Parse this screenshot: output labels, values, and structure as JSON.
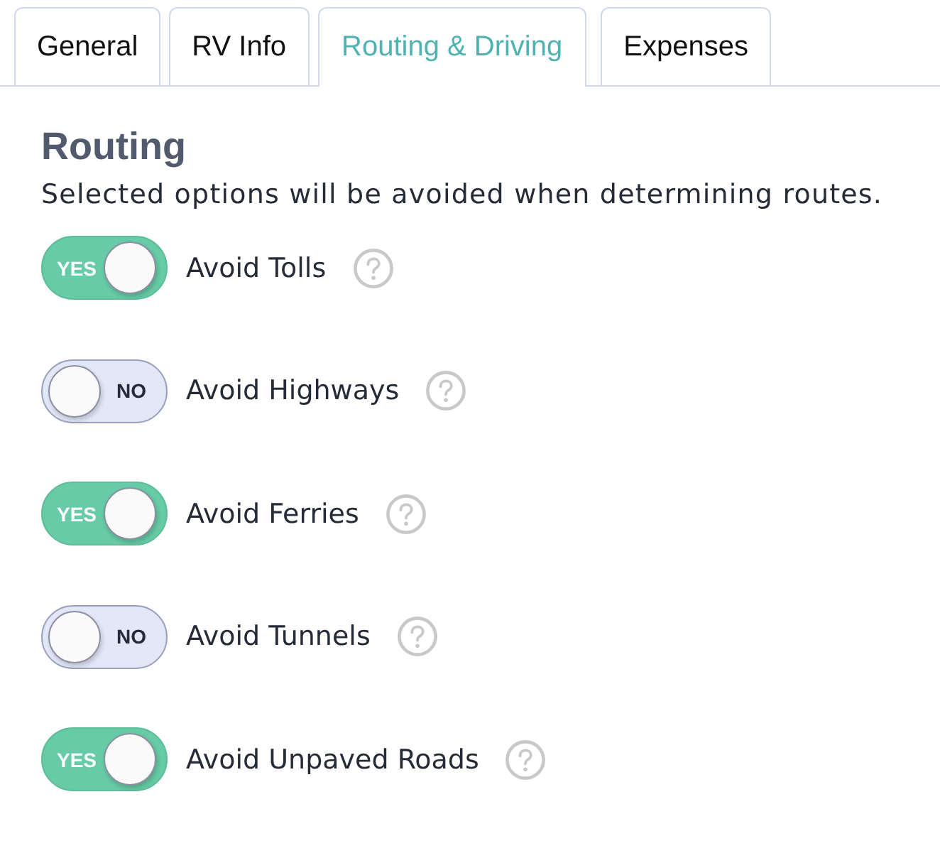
{
  "tabs": [
    {
      "label": "General",
      "selected": false
    },
    {
      "label": "RV Info",
      "selected": false
    },
    {
      "label": "Routing & Driving",
      "selected": true
    },
    {
      "label": "Expenses",
      "selected": false
    }
  ],
  "section": {
    "title": "Routing",
    "description": "Selected options will be avoided when determining routes."
  },
  "options": [
    {
      "label": "Avoid Tolls",
      "on": true,
      "switch_text": "YES"
    },
    {
      "label": "Avoid Highways",
      "on": false,
      "switch_text": "NO"
    },
    {
      "label": "Avoid Ferries",
      "on": true,
      "switch_text": "YES"
    },
    {
      "label": "Avoid Tunnels",
      "on": false,
      "switch_text": "NO"
    },
    {
      "label": "Avoid Unpaved Roads",
      "on": true,
      "switch_text": "YES"
    }
  ]
}
